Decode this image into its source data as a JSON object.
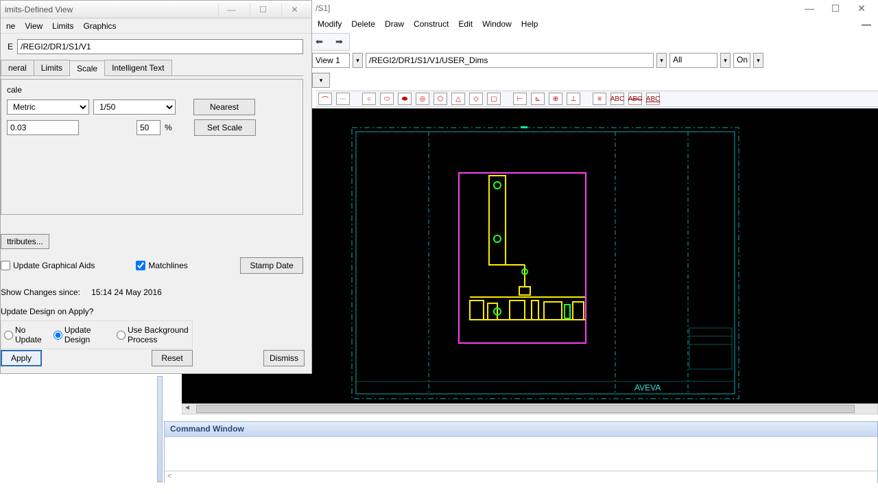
{
  "main_window": {
    "title": "/S1]",
    "menu": [
      "Modify",
      "Delete",
      "Draw",
      "Construct",
      "Edit",
      "Window",
      "Help"
    ]
  },
  "view_bar": {
    "view_label": "View 1",
    "path": "/REGI2/DR1/S1/V1/USER_Dims",
    "filter": "All",
    "state": "On"
  },
  "command": {
    "title": "Command Window",
    "prompt": "<"
  },
  "dialog": {
    "title": "imits-Defined View",
    "menu": [
      "ne",
      "View",
      "Limits",
      "Graphics"
    ],
    "path_label": "E",
    "path_value": "/REGI2/DR1/S1/V1",
    "tabs": [
      "neral",
      "Limits",
      "Scale",
      "Intelligent Text"
    ],
    "active_tab": "Scale",
    "scale": {
      "label": "cale",
      "unit": "Metric",
      "ratio": "1/50",
      "nearest": "Nearest",
      "factor": "0.03",
      "percent": "50",
      "pct_sym": "%",
      "set": "Set Scale"
    },
    "attributes": "ttributes...",
    "update_aids": "Update Graphical Aids",
    "matchlines": "Matchlines",
    "stamp": "Stamp Date",
    "changes_label": "Show Changes since:",
    "changes_value": "15:14 24 May 2016",
    "update_question": "Update Design on Apply?",
    "radios": {
      "no_update": "No Update",
      "update_design": "Update Design",
      "background": "Use Background Process"
    },
    "buttons": {
      "apply": "Apply",
      "reset": "Reset",
      "dismiss": "Dismiss"
    }
  }
}
